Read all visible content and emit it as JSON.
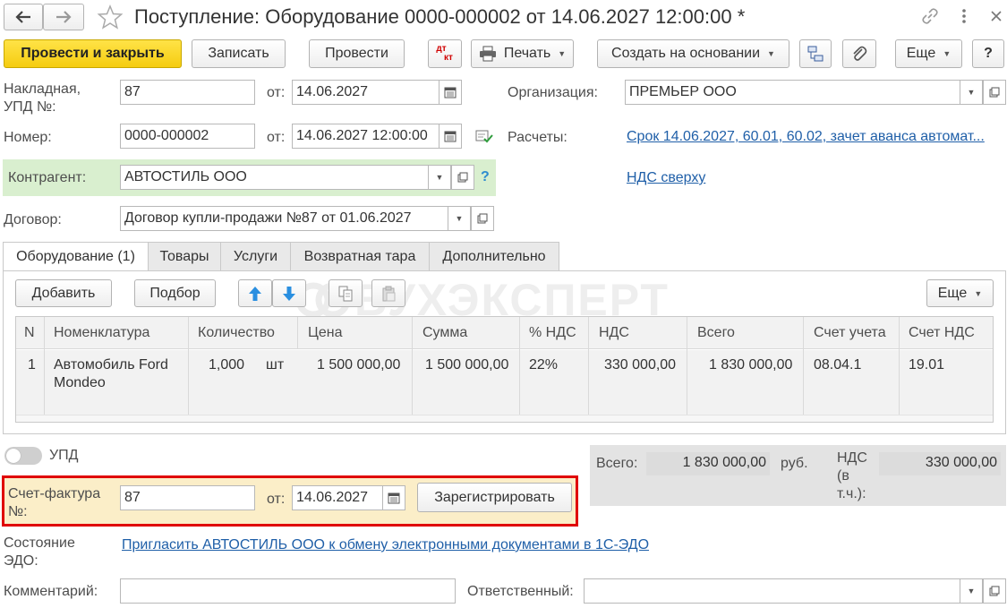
{
  "window": {
    "title": "Поступление: Оборудование 0000-000002 от 14.06.2027 12:00:00 *",
    "nav_back_icon": "arrow-left-icon",
    "nav_forward_icon": "arrow-right-icon",
    "favorite_icon": "star-icon"
  },
  "toolbar": {
    "post_close": "Провести и закрыть",
    "save": "Записать",
    "post": "Провести",
    "dt": "дт",
    "kt": "кт",
    "print": "Печать",
    "create_based": "Создать на основании",
    "more": "Еще",
    "help": "?"
  },
  "header": {
    "invoice_label": "Накладная, УПД №:",
    "invoice_value": "87",
    "from_label": "от:",
    "invoice_date": "14.06.2027",
    "number_label": "Номер:",
    "number_value": "0000-000002",
    "number_date": "14.06.2027 12:00:00",
    "organization_label": "Организация:",
    "organization_value": "ПРЕМЬЕР ООО",
    "settlements_label": "Расчеты:",
    "settlements_link": "Срок 14.06.2027, 60.01, 60.02, зачет аванса автомат...",
    "counterparty_label": "Контрагент:",
    "counterparty_value": "АВТОСТИЛЬ ООО",
    "help_q": "?",
    "vat_link": "НДС сверху",
    "contract_label": "Договор:",
    "contract_value": "Договор купли-продажи №87 от 01.06.2027"
  },
  "tabs": [
    {
      "label": "Оборудование (1)"
    },
    {
      "label": "Товары"
    },
    {
      "label": "Услуги"
    },
    {
      "label": "Возвратная тара"
    },
    {
      "label": "Дополнительно"
    }
  ],
  "table_toolbar": {
    "add": "Добавить",
    "pick": "Подбор",
    "more": "Еще",
    "watermark": "БУХЭКСПЕРТ"
  },
  "table": {
    "columns": [
      "N",
      "Номенклатура",
      "Количество",
      "Цена",
      "Сумма",
      "% НДС",
      "НДС",
      "Всего",
      "Счет учета",
      "Счет НДС"
    ],
    "rows": [
      {
        "n": "1",
        "item": "Автомобиль Ford Mondeo",
        "qty": "1,000",
        "unit": "шт",
        "price": "1 500 000,00",
        "sum": "1 500 000,00",
        "vat_rate": "22%",
        "vat": "330 000,00",
        "total": "1 830 000,00",
        "account": "08.04.1",
        "vat_account": "19.01"
      }
    ]
  },
  "upd": {
    "label": "УПД"
  },
  "totals": {
    "total_label": "Всего:",
    "total_value": "1 830 000,00",
    "currency": "руб.",
    "vat_label": "НДС (в т.ч.):",
    "vat_value": "330 000,00"
  },
  "invoice": {
    "label": "Счет-фактура №:",
    "number": "87",
    "from_label": "от:",
    "date": "14.06.2027",
    "register": "Зарегистрировать",
    "highlight_color": "#e00000"
  },
  "edo": {
    "label": "Состояние ЭДО:",
    "link": "Пригласить АВТОСТИЛЬ ООО к обмену электронными документами в 1С-ЭДО"
  },
  "footer": {
    "comment_label": "Комментарий:",
    "responsible_label": "Ответственный:"
  }
}
